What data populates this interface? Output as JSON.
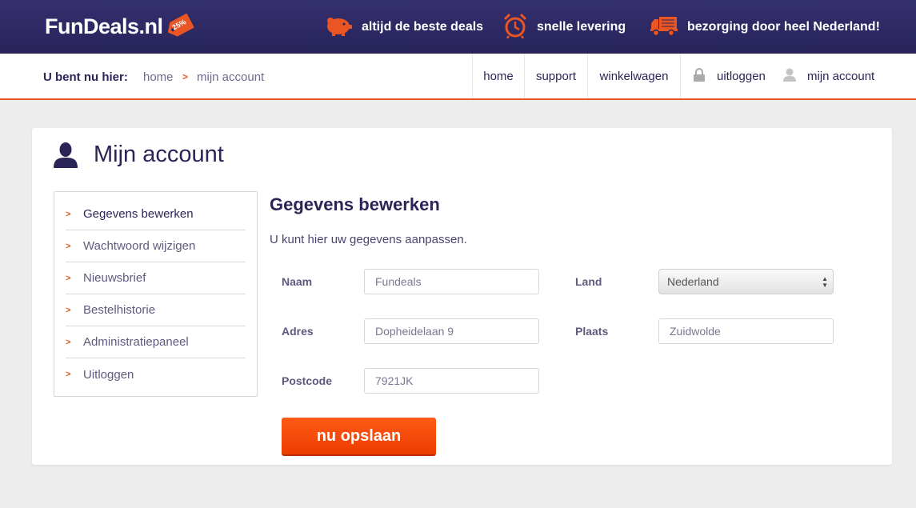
{
  "header": {
    "logo": "FunDeals.nl",
    "logo_tag": "25%",
    "usps": [
      {
        "icon": "piggy-bank-icon",
        "label": "altijd de beste deals"
      },
      {
        "icon": "alarm-clock-icon",
        "label": "snelle levering"
      },
      {
        "icon": "delivery-truck-icon",
        "label": "bezorging door heel Nederland!"
      }
    ],
    "accent_color": "#ea5524",
    "bg_color": "#2b2557"
  },
  "breadcrumb": {
    "title": "U bent nu hier:",
    "home": "home",
    "separator": ">",
    "current": "mijn account"
  },
  "nav": {
    "home": "home",
    "support": "support",
    "cart": "winkelwagen",
    "logout": "uitloggen",
    "account": "mijn account"
  },
  "page": {
    "title": "Mijn account"
  },
  "sidemenu": {
    "items": [
      {
        "label": "Gegevens bewerken",
        "active": true
      },
      {
        "label": "Wachtwoord wijzigen"
      },
      {
        "label": "Nieuwsbrief"
      },
      {
        "label": "Bestelhistorie"
      },
      {
        "label": "Administratiepaneel"
      },
      {
        "label": "Uitloggen"
      }
    ]
  },
  "form": {
    "title": "Gegevens bewerken",
    "subtitle": "U kunt hier uw gegevens aanpassen.",
    "naam_label": "Naam",
    "naam_value": "Fundeals",
    "adres_label": "Adres",
    "adres_value": "Dopheidelaan 9",
    "postcode_label": "Postcode",
    "postcode_value": "7921JK",
    "land_label": "Land",
    "land_value": "Nederland",
    "plaats_label": "Plaats",
    "plaats_value": "Zuidwolde",
    "save_label": "nu opslaan"
  }
}
